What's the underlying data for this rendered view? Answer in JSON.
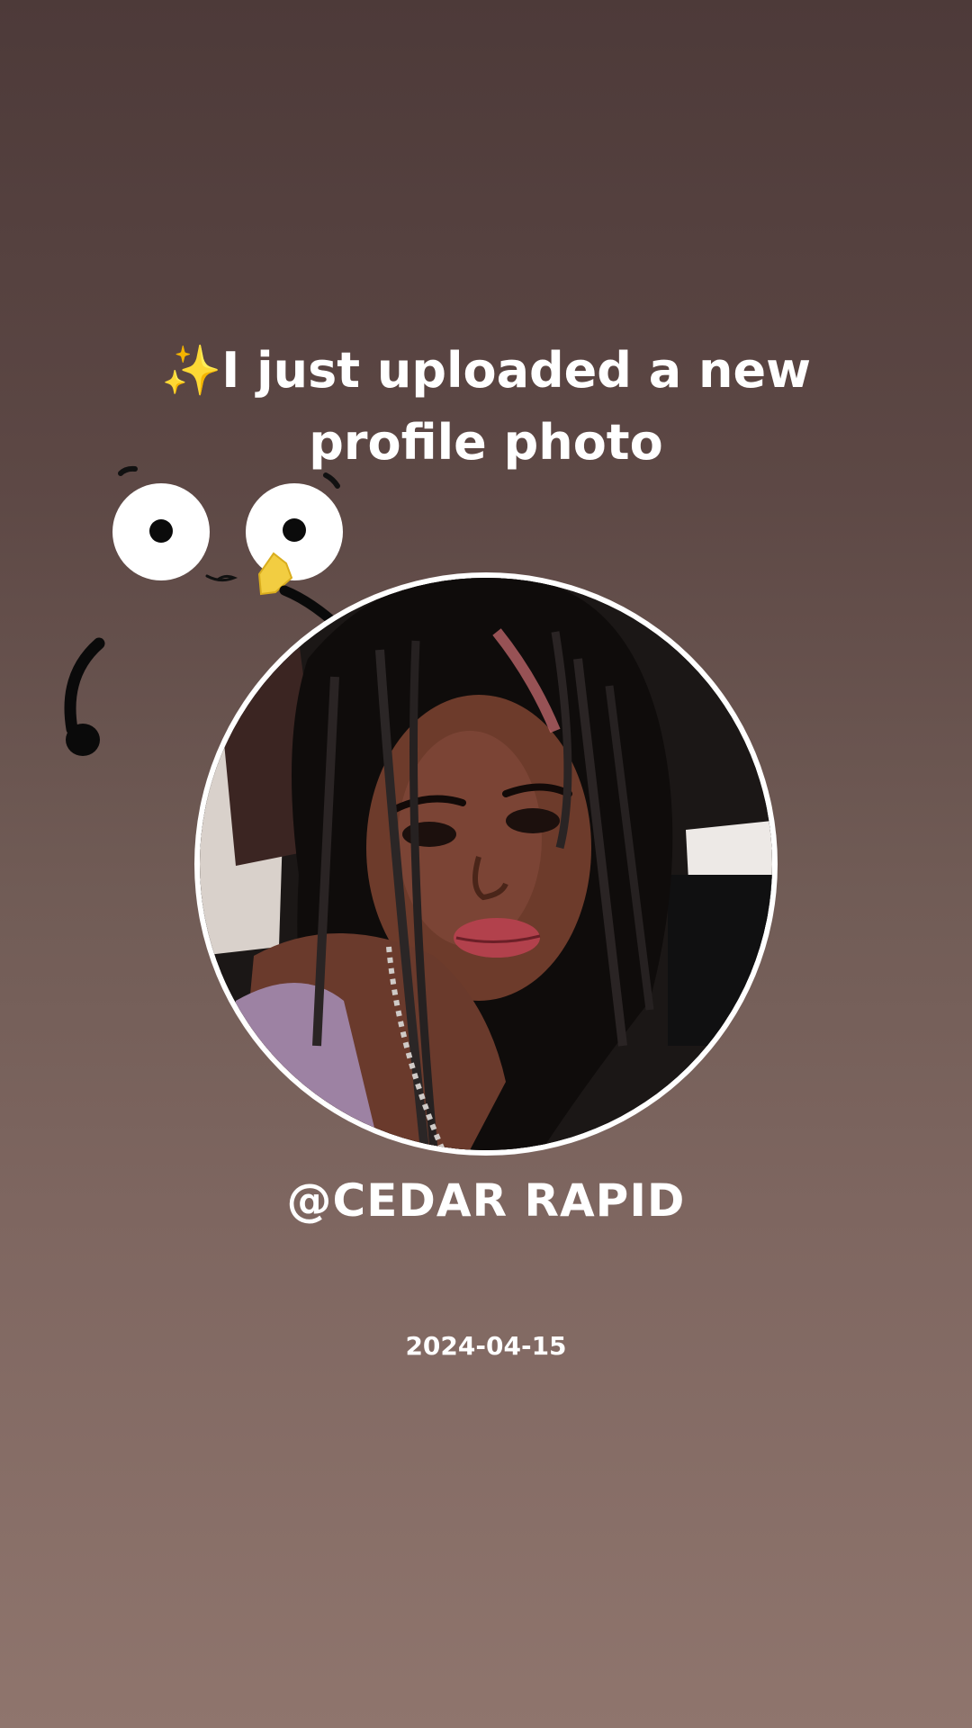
{
  "post": {
    "sparkle_icon": "✨",
    "headline": "I just uploaded a new profile photo",
    "username": "@CEDAR RAPID",
    "date": "2024-04-15"
  },
  "stickers": {
    "face_sticker_icon": "googly-eyes-face-sticker"
  },
  "avatar": {
    "subject_icon": "profile-photo"
  },
  "colors": {
    "background_top": "#4d3a39",
    "background_bottom": "#8f756d",
    "text": "#ffffff",
    "sparkle": "#f6cd33",
    "ring": "#ffffff"
  }
}
